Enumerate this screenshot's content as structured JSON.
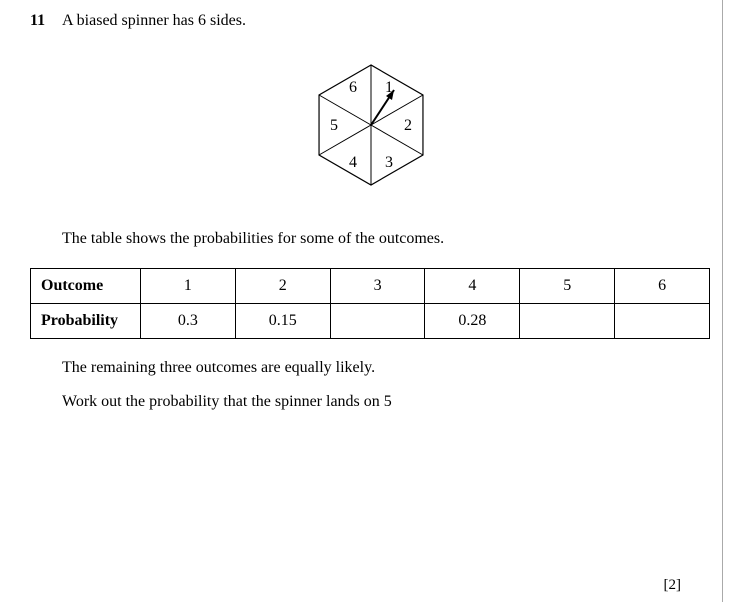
{
  "question": {
    "number": "11",
    "prompt": "A biased spinner has 6 sides.",
    "table_intro": "The table shows the probabilities for some of the outcomes.",
    "remaining_text": "The remaining three outcomes are equally likely.",
    "workout_text": "Work out the probability that the spinner lands on 5",
    "marks": "[2]"
  },
  "spinner": {
    "labels": [
      "1",
      "2",
      "3",
      "4",
      "5",
      "6"
    ]
  },
  "table": {
    "row1_header": "Outcome",
    "row2_header": "Probability",
    "outcomes": [
      "1",
      "2",
      "3",
      "4",
      "5",
      "6"
    ],
    "probabilities": [
      "0.3",
      "0.15",
      "",
      "0.28",
      "",
      ""
    ]
  }
}
